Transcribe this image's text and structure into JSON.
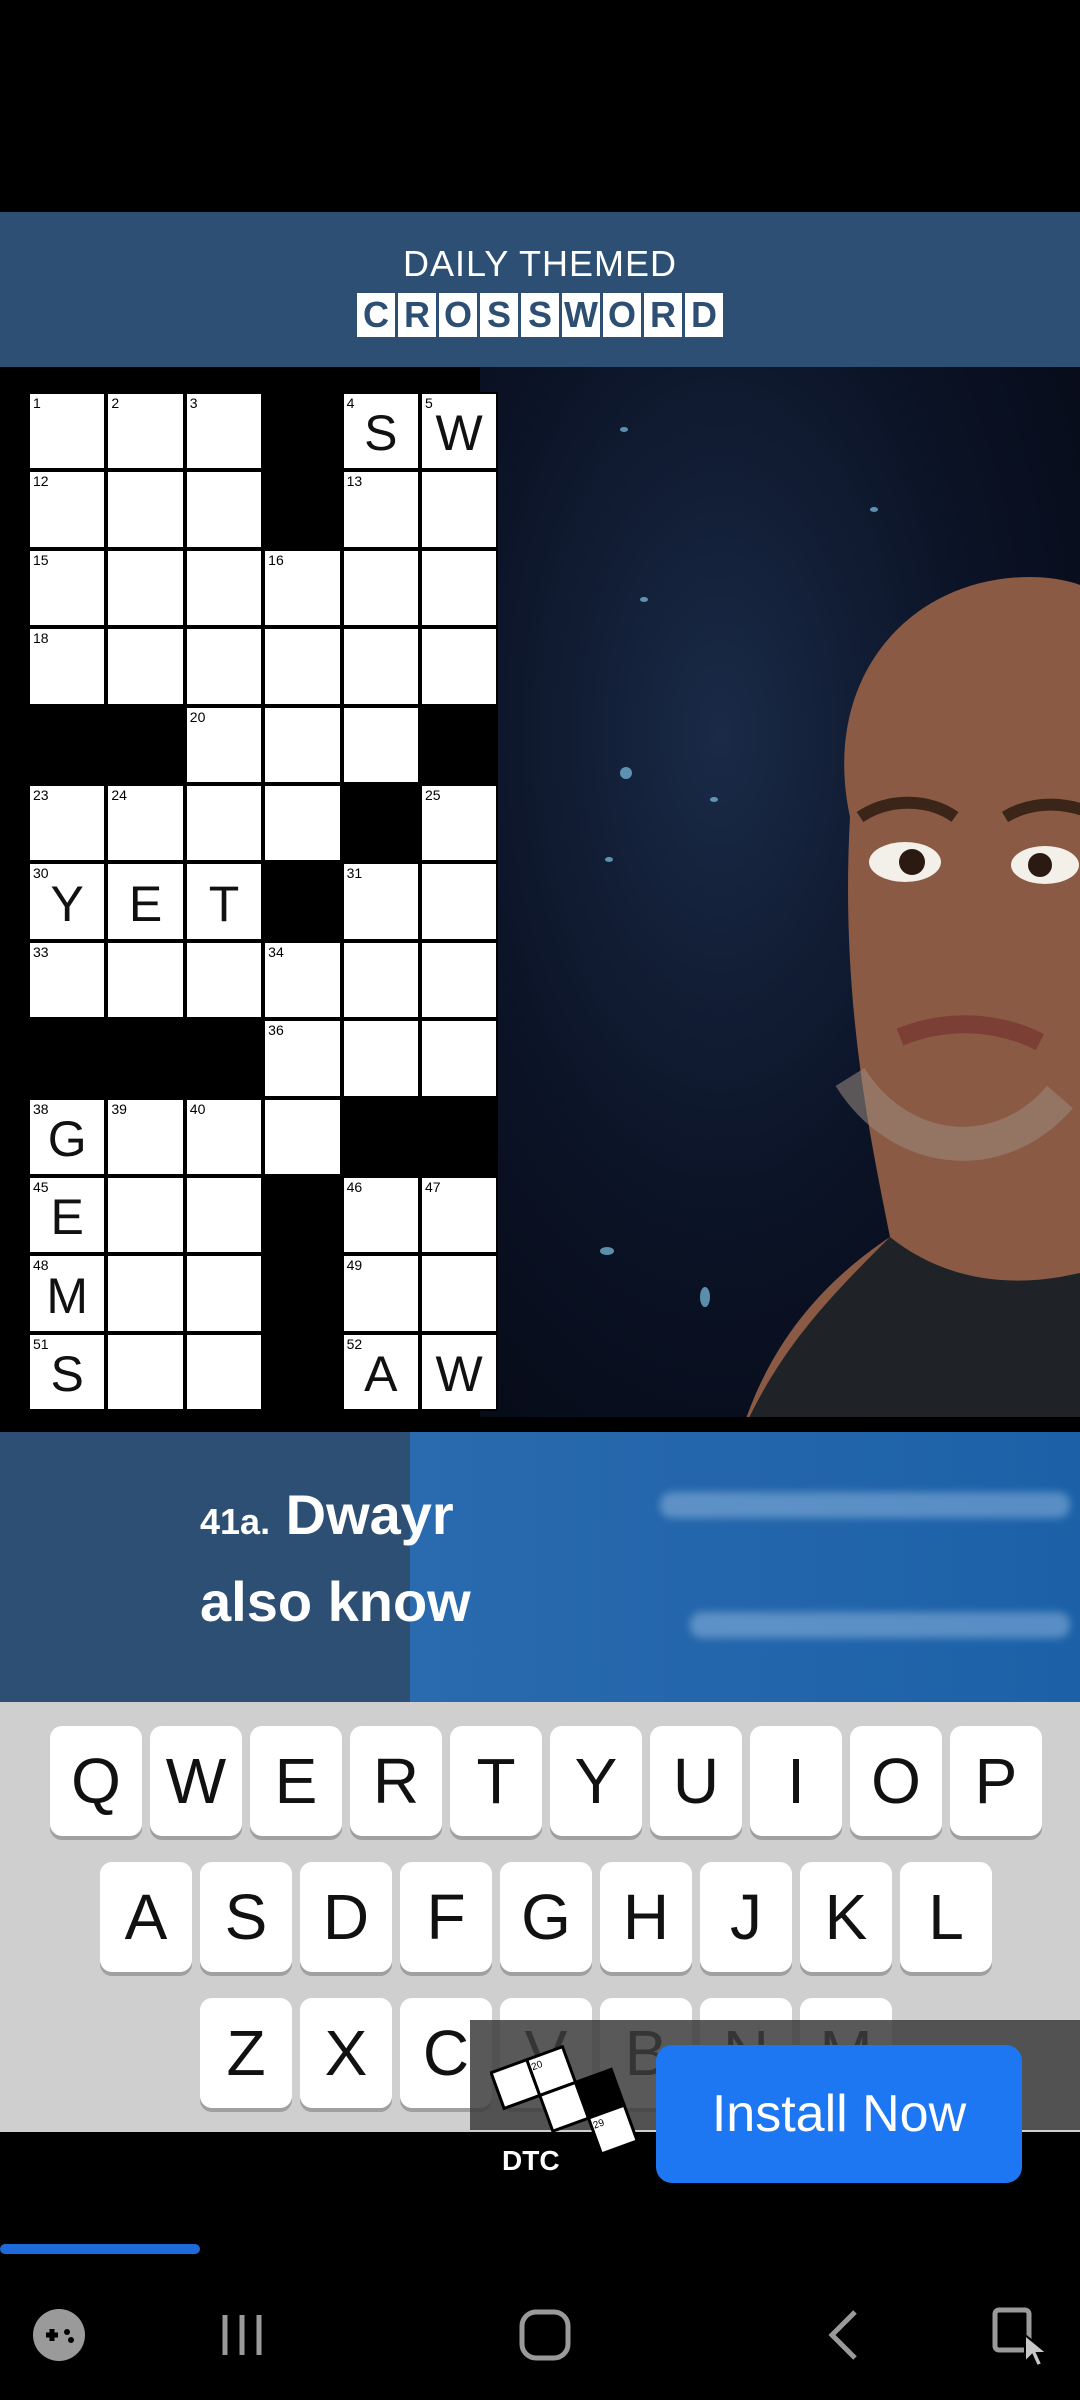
{
  "header": {
    "subtitle": "DAILY THEMED",
    "title_letters": [
      "C",
      "R",
      "O",
      "S",
      "S",
      "W",
      "O",
      "R",
      "D"
    ]
  },
  "grid": {
    "rows": [
      [
        {
          "n": "1",
          "l": ""
        },
        {
          "n": "2",
          "l": ""
        },
        {
          "n": "3",
          "l": ""
        },
        {
          "b": true
        },
        {
          "n": "4",
          "l": "S"
        },
        {
          "n": "5",
          "l": "W"
        }
      ],
      [
        {
          "n": "12",
          "l": ""
        },
        {
          "n": "",
          "l": ""
        },
        {
          "n": "",
          "l": ""
        },
        {
          "b": true
        },
        {
          "n": "13",
          "l": ""
        },
        {
          "n": "",
          "l": ""
        }
      ],
      [
        {
          "n": "15",
          "l": ""
        },
        {
          "n": "",
          "l": ""
        },
        {
          "n": "",
          "l": ""
        },
        {
          "n": "16",
          "l": ""
        },
        {
          "n": "",
          "l": ""
        },
        {
          "n": "",
          "l": ""
        }
      ],
      [
        {
          "n": "18",
          "l": ""
        },
        {
          "n": "",
          "l": ""
        },
        {
          "n": "",
          "l": ""
        },
        {
          "n": "",
          "l": ""
        },
        {
          "n": "",
          "l": ""
        },
        {
          "n": "",
          "l": ""
        }
      ],
      [
        {
          "b": true
        },
        {
          "b": true
        },
        {
          "n": "20",
          "l": ""
        },
        {
          "n": "",
          "l": ""
        },
        {
          "n": "",
          "l": ""
        },
        {
          "b": true
        }
      ],
      [
        {
          "n": "23",
          "l": ""
        },
        {
          "n": "24",
          "l": ""
        },
        {
          "n": "",
          "l": ""
        },
        {
          "n": "",
          "l": ""
        },
        {
          "b": true
        },
        {
          "n": "25",
          "l": ""
        }
      ],
      [
        {
          "n": "30",
          "l": "Y"
        },
        {
          "n": "",
          "l": "E"
        },
        {
          "n": "",
          "l": "T"
        },
        {
          "b": true
        },
        {
          "n": "31",
          "l": ""
        },
        {
          "n": "",
          "l": ""
        }
      ],
      [
        {
          "n": "33",
          "l": ""
        },
        {
          "n": "",
          "l": ""
        },
        {
          "n": "",
          "l": ""
        },
        {
          "n": "34",
          "l": ""
        },
        {
          "n": "",
          "l": ""
        },
        {
          "n": "",
          "l": ""
        }
      ],
      [
        {
          "b": true
        },
        {
          "b": true
        },
        {
          "b": true
        },
        {
          "n": "36",
          "l": ""
        },
        {
          "n": "",
          "l": ""
        },
        {
          "n": "",
          "l": ""
        }
      ],
      [
        {
          "n": "38",
          "l": "G"
        },
        {
          "n": "39",
          "l": ""
        },
        {
          "n": "40",
          "l": ""
        },
        {
          "n": "",
          "l": ""
        },
        {
          "b": true
        },
        {
          "b": true
        }
      ],
      [
        {
          "n": "45",
          "l": "E"
        },
        {
          "n": "",
          "l": ""
        },
        {
          "n": "",
          "l": ""
        },
        {
          "b": true
        },
        {
          "n": "46",
          "l": ""
        },
        {
          "n": "47",
          "l": ""
        }
      ],
      [
        {
          "n": "48",
          "l": "M"
        },
        {
          "n": "",
          "l": ""
        },
        {
          "n": "",
          "l": ""
        },
        {
          "b": true
        },
        {
          "n": "49",
          "l": ""
        },
        {
          "n": "",
          "l": ""
        }
      ],
      [
        {
          "n": "51",
          "l": "S"
        },
        {
          "n": "",
          "l": ""
        },
        {
          "n": "",
          "l": ""
        },
        {
          "b": true
        },
        {
          "n": "52",
          "l": "A"
        },
        {
          "n": "",
          "l": "W"
        }
      ]
    ]
  },
  "clue": {
    "number": "41a.",
    "line1": "Dwayr",
    "line2": "also know"
  },
  "keyboard": {
    "row1": [
      "Q",
      "W",
      "E",
      "R",
      "T",
      "Y",
      "U",
      "I",
      "O",
      "P"
    ],
    "row2": [
      "A",
      "S",
      "D",
      "F",
      "G",
      "H",
      "J",
      "K",
      "L"
    ],
    "row3": [
      "Z",
      "X",
      "C",
      "V",
      "B",
      "N",
      "M"
    ]
  },
  "ad": {
    "logo_text": "DTC",
    "install_label": "Install Now"
  },
  "video_progress": 0.185,
  "colors": {
    "header_bg": "#2d4f73",
    "install_button": "#1d77f2",
    "progress": "#1d6ad8"
  },
  "navbar": {
    "icons": [
      "game-launcher-icon",
      "recent-apps-icon",
      "home-icon",
      "back-icon",
      "screen-assist-icon"
    ]
  }
}
